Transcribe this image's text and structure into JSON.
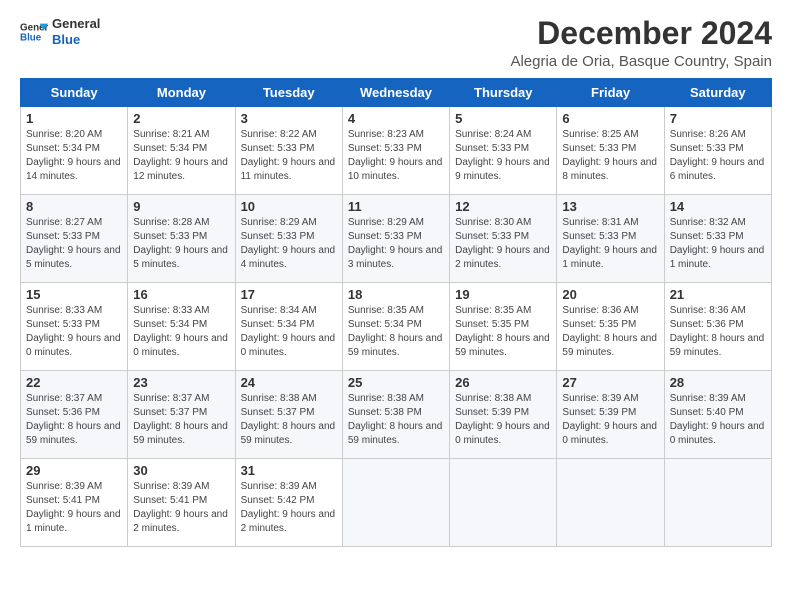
{
  "logo": {
    "line1": "General",
    "line2": "Blue"
  },
  "title": "December 2024",
  "location": "Alegria de Oria, Basque Country, Spain",
  "days_of_week": [
    "Sunday",
    "Monday",
    "Tuesday",
    "Wednesday",
    "Thursday",
    "Friday",
    "Saturday"
  ],
  "weeks": [
    [
      {
        "day": "1",
        "sunrise": "Sunrise: 8:20 AM",
        "sunset": "Sunset: 5:34 PM",
        "daylight": "Daylight: 9 hours and 14 minutes."
      },
      {
        "day": "2",
        "sunrise": "Sunrise: 8:21 AM",
        "sunset": "Sunset: 5:34 PM",
        "daylight": "Daylight: 9 hours and 12 minutes."
      },
      {
        "day": "3",
        "sunrise": "Sunrise: 8:22 AM",
        "sunset": "Sunset: 5:33 PM",
        "daylight": "Daylight: 9 hours and 11 minutes."
      },
      {
        "day": "4",
        "sunrise": "Sunrise: 8:23 AM",
        "sunset": "Sunset: 5:33 PM",
        "daylight": "Daylight: 9 hours and 10 minutes."
      },
      {
        "day": "5",
        "sunrise": "Sunrise: 8:24 AM",
        "sunset": "Sunset: 5:33 PM",
        "daylight": "Daylight: 9 hours and 9 minutes."
      },
      {
        "day": "6",
        "sunrise": "Sunrise: 8:25 AM",
        "sunset": "Sunset: 5:33 PM",
        "daylight": "Daylight: 9 hours and 8 minutes."
      },
      {
        "day": "7",
        "sunrise": "Sunrise: 8:26 AM",
        "sunset": "Sunset: 5:33 PM",
        "daylight": "Daylight: 9 hours and 6 minutes."
      }
    ],
    [
      {
        "day": "8",
        "sunrise": "Sunrise: 8:27 AM",
        "sunset": "Sunset: 5:33 PM",
        "daylight": "Daylight: 9 hours and 5 minutes."
      },
      {
        "day": "9",
        "sunrise": "Sunrise: 8:28 AM",
        "sunset": "Sunset: 5:33 PM",
        "daylight": "Daylight: 9 hours and 5 minutes."
      },
      {
        "day": "10",
        "sunrise": "Sunrise: 8:29 AM",
        "sunset": "Sunset: 5:33 PM",
        "daylight": "Daylight: 9 hours and 4 minutes."
      },
      {
        "day": "11",
        "sunrise": "Sunrise: 8:29 AM",
        "sunset": "Sunset: 5:33 PM",
        "daylight": "Daylight: 9 hours and 3 minutes."
      },
      {
        "day": "12",
        "sunrise": "Sunrise: 8:30 AM",
        "sunset": "Sunset: 5:33 PM",
        "daylight": "Daylight: 9 hours and 2 minutes."
      },
      {
        "day": "13",
        "sunrise": "Sunrise: 8:31 AM",
        "sunset": "Sunset: 5:33 PM",
        "daylight": "Daylight: 9 hours and 1 minute."
      },
      {
        "day": "14",
        "sunrise": "Sunrise: 8:32 AM",
        "sunset": "Sunset: 5:33 PM",
        "daylight": "Daylight: 9 hours and 1 minute."
      }
    ],
    [
      {
        "day": "15",
        "sunrise": "Sunrise: 8:33 AM",
        "sunset": "Sunset: 5:33 PM",
        "daylight": "Daylight: 9 hours and 0 minutes."
      },
      {
        "day": "16",
        "sunrise": "Sunrise: 8:33 AM",
        "sunset": "Sunset: 5:34 PM",
        "daylight": "Daylight: 9 hours and 0 minutes."
      },
      {
        "day": "17",
        "sunrise": "Sunrise: 8:34 AM",
        "sunset": "Sunset: 5:34 PM",
        "daylight": "Daylight: 9 hours and 0 minutes."
      },
      {
        "day": "18",
        "sunrise": "Sunrise: 8:35 AM",
        "sunset": "Sunset: 5:34 PM",
        "daylight": "Daylight: 8 hours and 59 minutes."
      },
      {
        "day": "19",
        "sunrise": "Sunrise: 8:35 AM",
        "sunset": "Sunset: 5:35 PM",
        "daylight": "Daylight: 8 hours and 59 minutes."
      },
      {
        "day": "20",
        "sunrise": "Sunrise: 8:36 AM",
        "sunset": "Sunset: 5:35 PM",
        "daylight": "Daylight: 8 hours and 59 minutes."
      },
      {
        "day": "21",
        "sunrise": "Sunrise: 8:36 AM",
        "sunset": "Sunset: 5:36 PM",
        "daylight": "Daylight: 8 hours and 59 minutes."
      }
    ],
    [
      {
        "day": "22",
        "sunrise": "Sunrise: 8:37 AM",
        "sunset": "Sunset: 5:36 PM",
        "daylight": "Daylight: 8 hours and 59 minutes."
      },
      {
        "day": "23",
        "sunrise": "Sunrise: 8:37 AM",
        "sunset": "Sunset: 5:37 PM",
        "daylight": "Daylight: 8 hours and 59 minutes."
      },
      {
        "day": "24",
        "sunrise": "Sunrise: 8:38 AM",
        "sunset": "Sunset: 5:37 PM",
        "daylight": "Daylight: 8 hours and 59 minutes."
      },
      {
        "day": "25",
        "sunrise": "Sunrise: 8:38 AM",
        "sunset": "Sunset: 5:38 PM",
        "daylight": "Daylight: 8 hours and 59 minutes."
      },
      {
        "day": "26",
        "sunrise": "Sunrise: 8:38 AM",
        "sunset": "Sunset: 5:39 PM",
        "daylight": "Daylight: 9 hours and 0 minutes."
      },
      {
        "day": "27",
        "sunrise": "Sunrise: 8:39 AM",
        "sunset": "Sunset: 5:39 PM",
        "daylight": "Daylight: 9 hours and 0 minutes."
      },
      {
        "day": "28",
        "sunrise": "Sunrise: 8:39 AM",
        "sunset": "Sunset: 5:40 PM",
        "daylight": "Daylight: 9 hours and 0 minutes."
      }
    ],
    [
      {
        "day": "29",
        "sunrise": "Sunrise: 8:39 AM",
        "sunset": "Sunset: 5:41 PM",
        "daylight": "Daylight: 9 hours and 1 minute."
      },
      {
        "day": "30",
        "sunrise": "Sunrise: 8:39 AM",
        "sunset": "Sunset: 5:41 PM",
        "daylight": "Daylight: 9 hours and 2 minutes."
      },
      {
        "day": "31",
        "sunrise": "Sunrise: 8:39 AM",
        "sunset": "Sunset: 5:42 PM",
        "daylight": "Daylight: 9 hours and 2 minutes."
      },
      null,
      null,
      null,
      null
    ]
  ]
}
